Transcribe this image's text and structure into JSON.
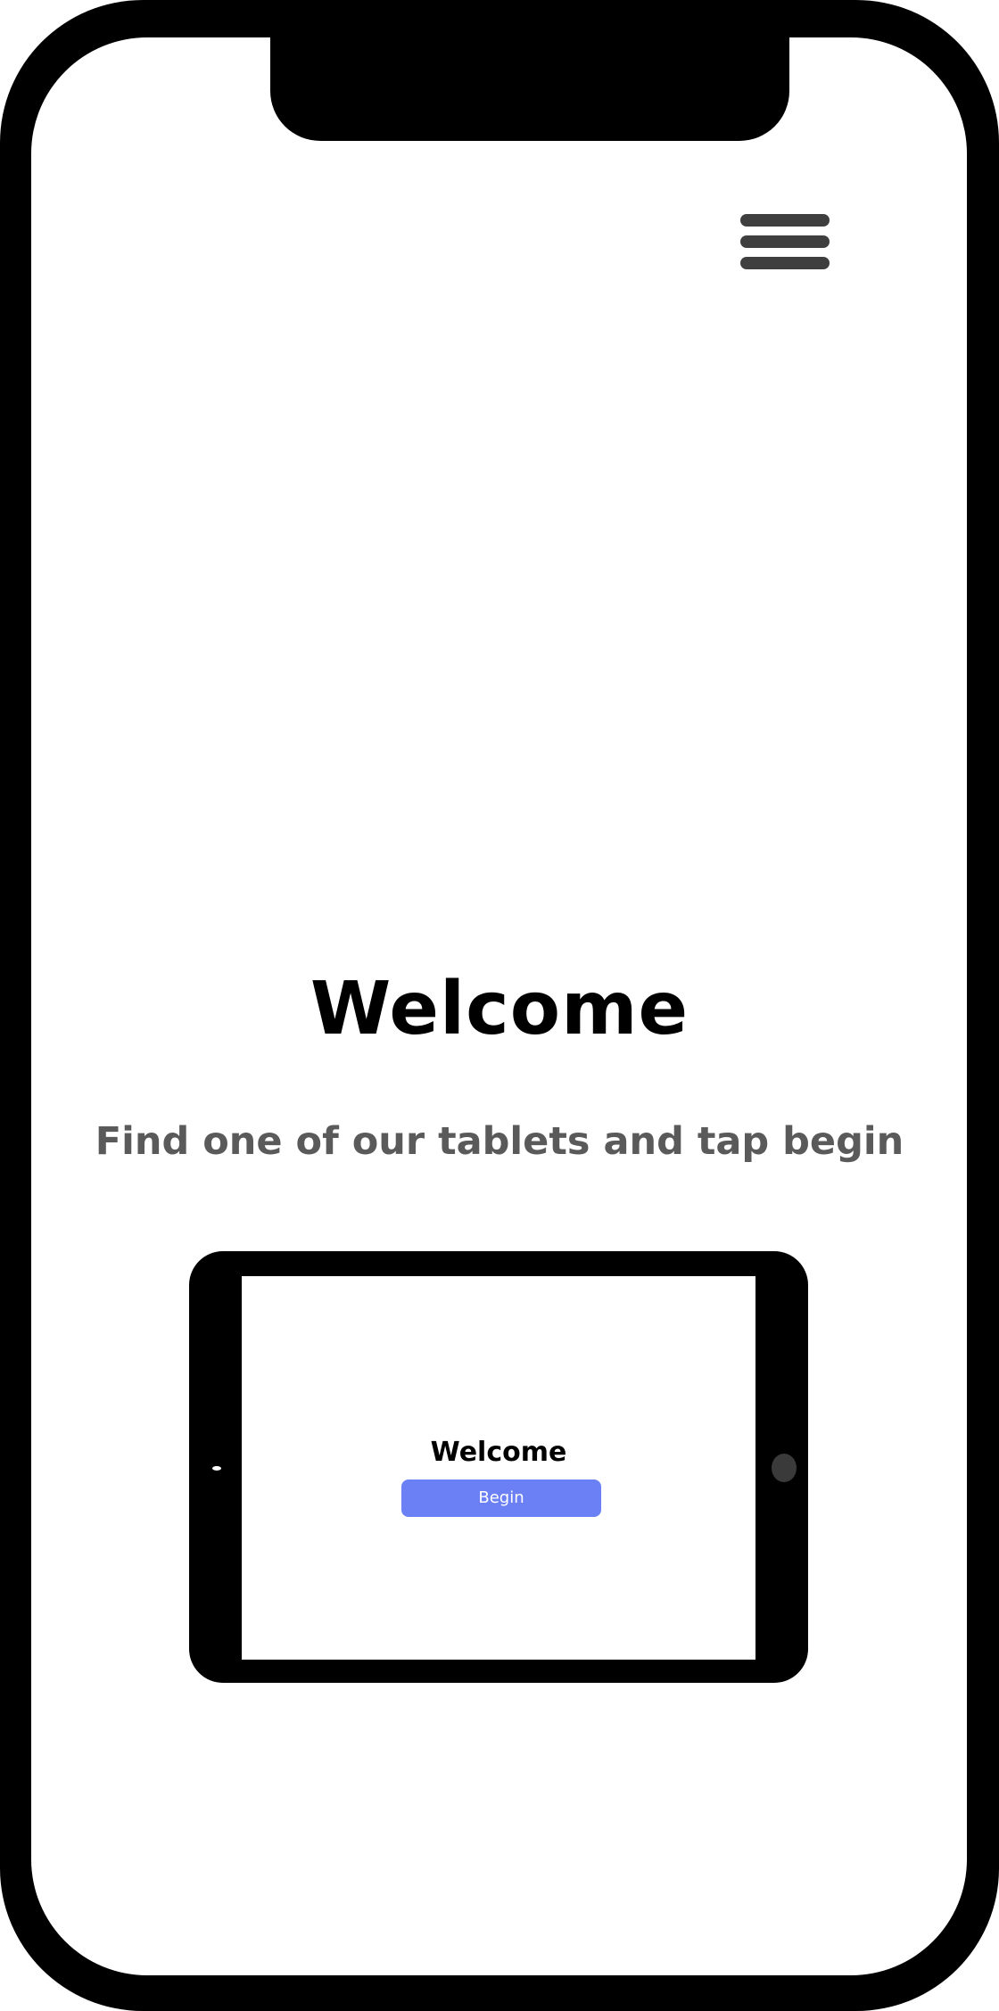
{
  "header": {
    "menu_icon": "hamburger-menu-icon"
  },
  "main": {
    "title": "Welcome",
    "subtitle": "Find one of our tablets and tap begin"
  },
  "tablet_preview": {
    "title": "Welcome",
    "begin_label": "Begin",
    "accent_color": "#6b80f5"
  }
}
